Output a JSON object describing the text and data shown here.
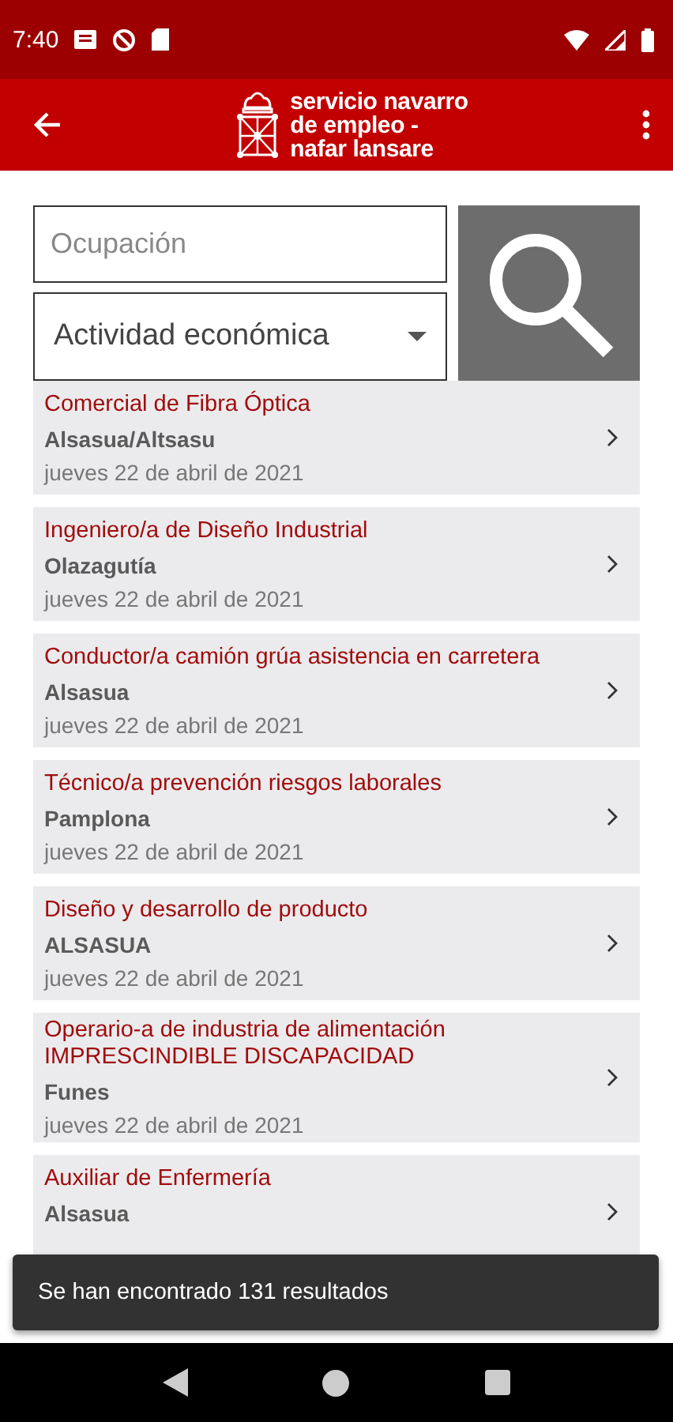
{
  "status_bar": {
    "time": "7:40"
  },
  "app_bar": {
    "brand_lines": [
      "servicio navarro",
      "de empleo -",
      "nafar lansare"
    ]
  },
  "search": {
    "occupation_placeholder": "Ocupación",
    "activity_placeholder": "Actividad económica"
  },
  "results": [
    {
      "title": "Comercial de Fibra Óptica",
      "location": "Alsasua/Altsasu",
      "date": "jueves 22 de abril de 2021"
    },
    {
      "title": "Ingeniero/a de Diseño Industrial",
      "location": "Olazagutía",
      "date": "jueves 22 de abril de 2021"
    },
    {
      "title": "Conductor/a camión grúa asistencia en carretera",
      "location": "Alsasua",
      "date": "jueves 22 de abril de 2021"
    },
    {
      "title": "Técnico/a prevención riesgos laborales",
      "location": "Pamplona",
      "date": "jueves 22 de abril de 2021"
    },
    {
      "title": "Diseño y desarrollo de producto",
      "location": "ALSASUA",
      "date": "jueves 22 de abril de 2021"
    },
    {
      "title": "Operario-a de industria de alimentación IMPRESCINDIBLE DISCAPACIDAD",
      "location": "Funes",
      "date": "jueves 22 de abril de 2021"
    },
    {
      "title": "Auxiliar de Enfermería",
      "location": "Alsasua"
    }
  ],
  "snackbar": {
    "message": "Se han encontrado 131 resultados"
  }
}
